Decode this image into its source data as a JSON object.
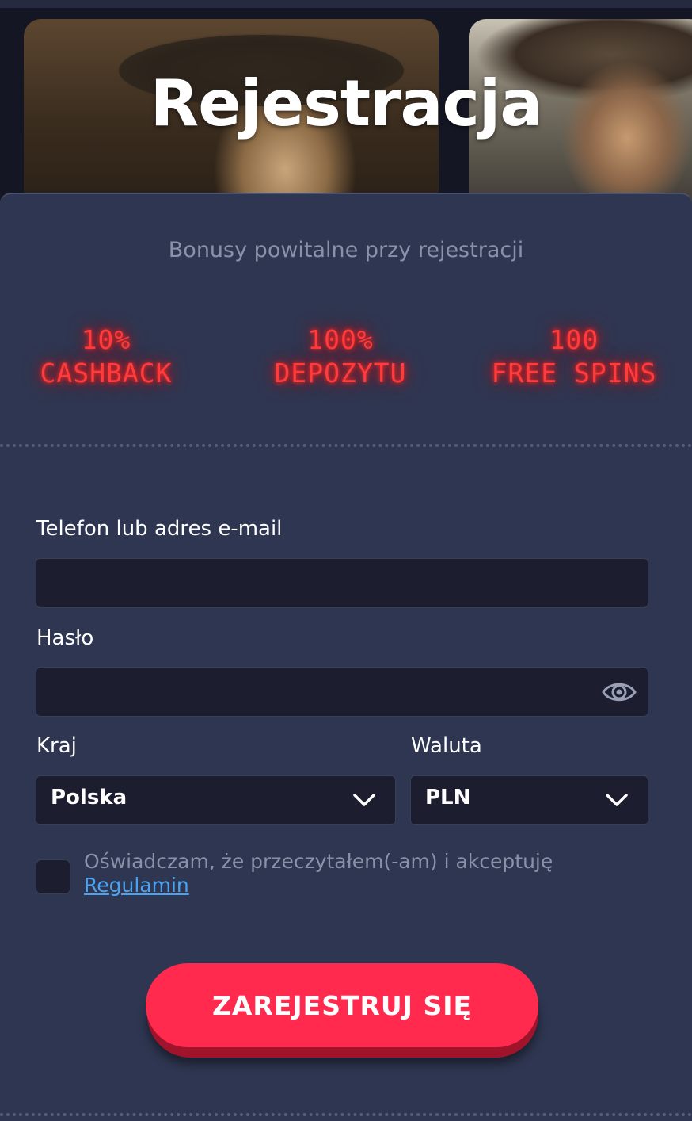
{
  "header": {
    "title": "Rejestracja"
  },
  "bonuses": {
    "subtitle": "Bonusy powitalne przy rejestracji",
    "items": [
      {
        "amount": "10%",
        "label": "CASHBACK"
      },
      {
        "amount": "100%",
        "label": "DEPOZYTU"
      },
      {
        "amount": "100",
        "label": "FREE SPINS"
      }
    ]
  },
  "form": {
    "login_label": "Telefon lub adres e-mail",
    "login_value": "",
    "password_label": "Hasło",
    "password_value": "",
    "country_label": "Kraj",
    "country_value": "Polska",
    "currency_label": "Waluta",
    "currency_value": "PLN",
    "terms_text": "Oświadczam, że przeczytałem(-am) i akceptuję",
    "terms_link": "Regulamin",
    "submit_label": "ZAREJESTRUJ SIĘ"
  },
  "colors": {
    "accent": "#ff2a4d",
    "neon": "#ff3b3b",
    "link": "#4aa3f0",
    "panel": "#2f3651",
    "field": "#1c1d2e"
  },
  "icons": {
    "password_toggle": "eye-icon",
    "select_arrow": "chevron-down-icon"
  }
}
